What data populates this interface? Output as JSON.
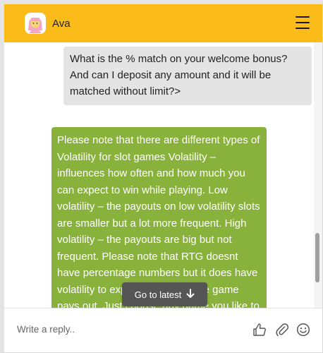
{
  "header": {
    "agent_name": "Ava",
    "avatar_icon": "woman-avatar-icon",
    "menu_icon": "hamburger-menu-icon",
    "background": "#fbbc19"
  },
  "messages": [
    {
      "from": "user",
      "text": "What is the % match on your welcome bonus? And can I deposit any amount and it will be matched without limit?>"
    },
    {
      "from": "agent",
      "text": "Please note that there are different types of Volatility for slot games Volatility – influences how often and how much you can expect to win while playing. Low volatility – the payouts on low volatility slots are smaller but a lot more frequent. High volatility – the payouts are big but not frequent. Please note that RTG doesnt have percentage numbers but it does have volatility to explain how often the game pays out, Just choose any game you like to play and"
    }
  ],
  "go_latest": {
    "label": "Go to latest",
    "icon": "arrow-down-icon"
  },
  "composer": {
    "placeholder": "Write a reply..",
    "icons": [
      "thumbs-up-icon",
      "paperclip-icon",
      "smiley-icon"
    ]
  },
  "colors": {
    "agent_bubble": "#88b23c",
    "user_bubble": "#e4e4e4",
    "go_latest_bg": "#555555"
  }
}
